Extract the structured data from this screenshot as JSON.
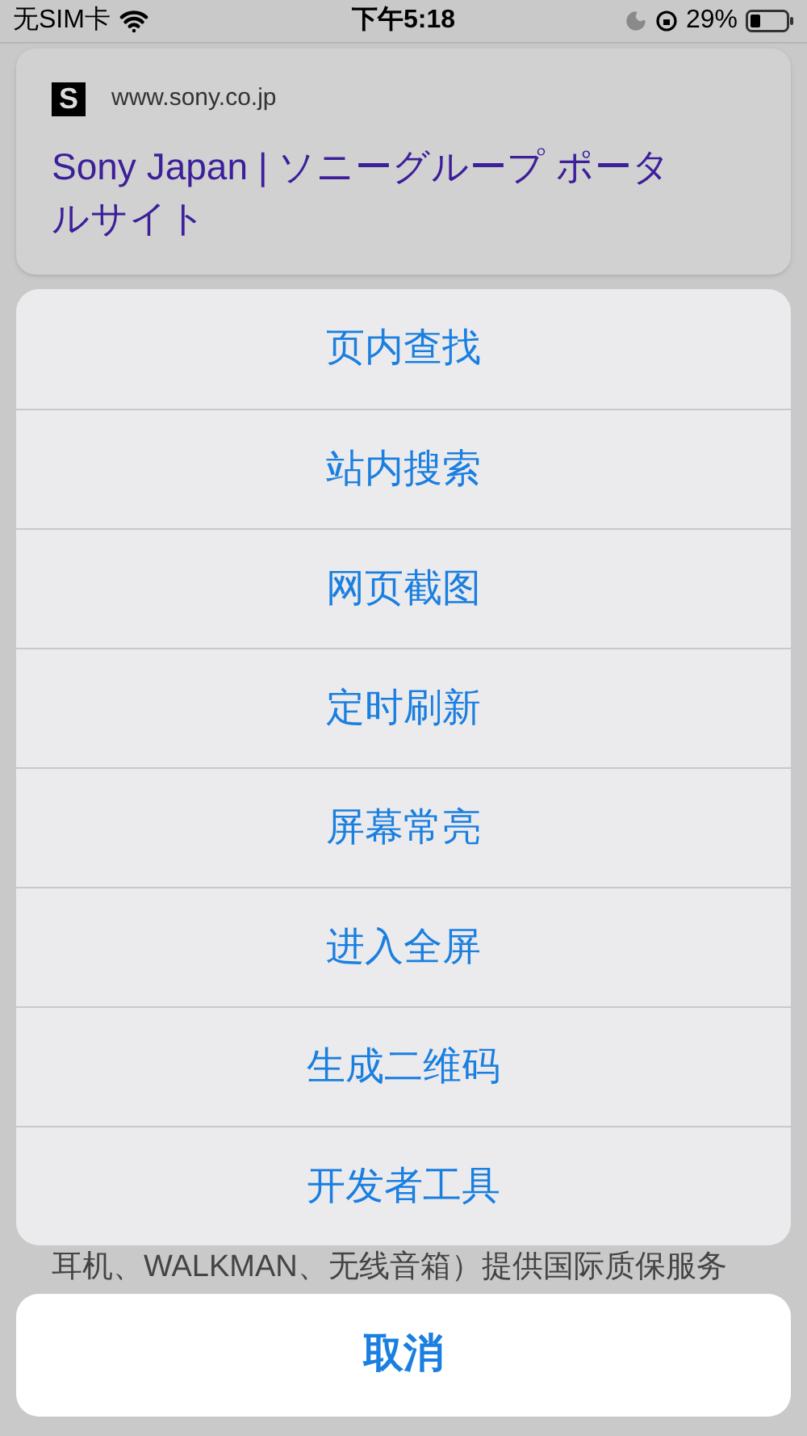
{
  "status_bar": {
    "carrier": "无SIM卡",
    "time": "下午5:18",
    "battery": "29%"
  },
  "preview": {
    "logo": "S",
    "url": "www.sony.co.jp",
    "title": "Sony Japan | ソニーグループ ポータルサイト"
  },
  "menu": [
    "页内查找",
    "站内搜索",
    "网页截图",
    "定时刷新",
    "屏幕常亮",
    "进入全屏",
    "生成二维码",
    "开发者工具"
  ],
  "background_text": "耳机、WALKMAN、无线音箱）提供国际质保服务",
  "cancel": "取消"
}
